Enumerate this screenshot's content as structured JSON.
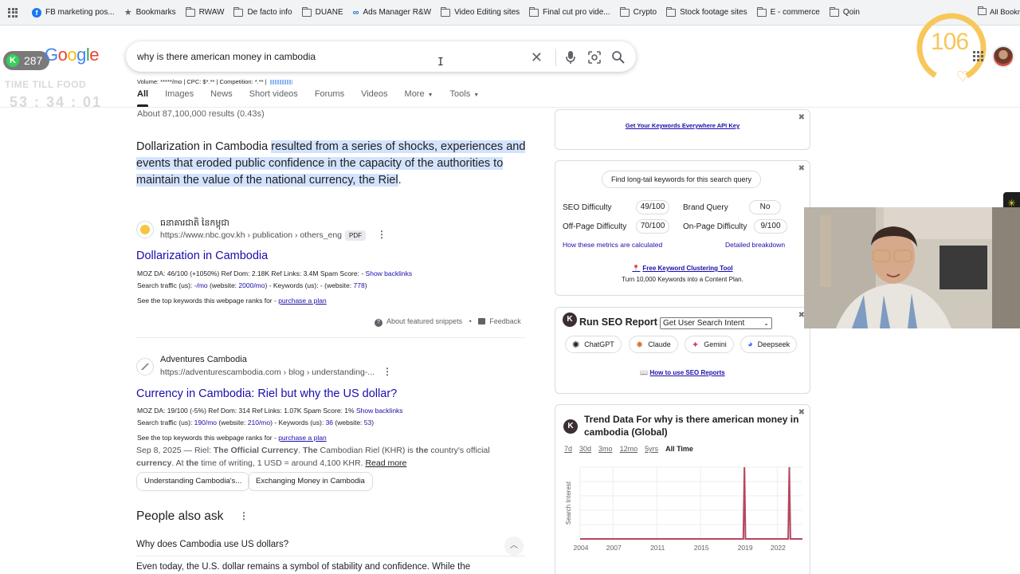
{
  "bookmarks": [
    {
      "label": "FB marketing pos...",
      "icon": "facebook-icon"
    },
    {
      "label": "Bookmarks",
      "icon": "star-icon"
    },
    {
      "label": "RWAW",
      "icon": "folder-icon"
    },
    {
      "label": "De facto info",
      "icon": "folder-icon"
    },
    {
      "label": "DUANE",
      "icon": "folder-icon"
    },
    {
      "label": "Ads Manager R&W",
      "icon": "meta-icon"
    },
    {
      "label": "Video Editing sites",
      "icon": "folder-icon"
    },
    {
      "label": "Final cut pro vide...",
      "icon": "folder-icon"
    },
    {
      "label": "Crypto",
      "icon": "folder-icon"
    },
    {
      "label": "Stock footage sites",
      "icon": "folder-icon"
    },
    {
      "label": "E - commerce",
      "icon": "folder-icon"
    },
    {
      "label": "Qoin",
      "icon": "folder-icon"
    }
  ],
  "all_bookmarks": "All Bookmarks",
  "overlay": {
    "k_count": "287",
    "timer_label": "TIME TILL FOOD",
    "timer": "53 : 34 : 01",
    "seo_score": "106"
  },
  "google_logo": [
    "G",
    "o",
    "o",
    "g",
    "l",
    "e"
  ],
  "search": {
    "query": "why is there american money in cambodia",
    "volume_line": "Volume: *****/mo | CPC: $*.** | Competition: *.** |"
  },
  "tabs": [
    "All",
    "Images",
    "News",
    "Short videos",
    "Forums",
    "Videos",
    "More",
    "Tools"
  ],
  "stats": "About 87,100,000 results (0.43s)",
  "featured": {
    "plain": "Dollarization in Cambodia ",
    "highlight": "resulted from a series of shocks, experiences and events that eroded public confidence in the capacity of the authorities to maintain the value of the national currency, the Riel",
    "end": ".",
    "site_name": "ធនាគារជាតិ នៃកម្ពុជា",
    "url": "https://www.nbc.gov.kh › publication › others_eng",
    "badge": "PDF",
    "title": "Dollarization in Cambodia",
    "moz": "MOZ DA: 46/100 (+1050%)     Ref Dom: 2.18K     Ref Links: 3.4M     Spam Score: -",
    "show_backlinks": "Show backlinks",
    "traffic_prefix": "Search traffic (us): ",
    "traffic_mo": "-/mo",
    "traffic_mid": " (website: ",
    "traffic_site": "2000/mo",
    "traffic_kw": ") - Keywords (us): - (website: ",
    "traffic_kw_site": "778",
    "traffic_end": ")",
    "top_kw": "See the top keywords this webpage ranks for - ",
    "purchase": "purchase a plan",
    "about": "About featured snippets",
    "feedback": "Feedback"
  },
  "result2": {
    "site_name": "Adventures Cambodia",
    "url": "https://adventurescambodia.com › blog › understanding-...",
    "title": "Currency in Cambodia: Riel but why the US dollar?",
    "moz": "MOZ DA: 19/100 (-5%)     Ref Dom: 314     Ref Links: 1.07K     Spam Score: 1%",
    "show_backlinks": "Show backlinks",
    "traffic_prefix": "Search traffic (us): ",
    "traffic_mo": "190/mo",
    "traffic_mid": " (website: ",
    "traffic_site": "210/mo",
    "traffic_kw": ") - Keywords (us): ",
    "traffic_kw_val": "36",
    "traffic_kw2": " (website: ",
    "traffic_kw_site": "53",
    "traffic_end": ")",
    "top_kw": "See the top keywords this webpage ranks for - ",
    "purchase": "purchase a plan",
    "date": "Sep 8, 2025 — Riel: ",
    "b1": "The Official Currency",
    "mid1": ". ",
    "b2": "The",
    "mid2": " Cambodian Riel (KHR) is ",
    "b3": "the",
    "mid3": " country's official ",
    "b4": "currency",
    "mid4": ". At ",
    "b5": "the",
    "mid5": " time of writing, 1 USD = around 4,100 KHR.  ",
    "read_more": "Read more",
    "chips": [
      "Understanding Cambodia's...",
      "Exchanging Money in Cambodia"
    ]
  },
  "paa": {
    "heading": "People also ask",
    "q1": "Why does Cambodia use US dollars?",
    "answer_start": "Even today, the U.S. dollar remains a symbol of stability and confidence. While the"
  },
  "panel1": {
    "link": "Get Your Keywords Everywhere API Key"
  },
  "panel2": {
    "button": "Find long-tail keywords for this search query",
    "seo_difficulty_label": "SEO Difficulty",
    "seo_difficulty": "49/100",
    "brand_query_label": "Brand Query",
    "brand_query": "No",
    "offpage_label": "Off-Page Difficulty",
    "offpage": "70/100",
    "onpage_label": "On-Page Difficulty",
    "onpage": "9/100",
    "how_link": "How these metrics are calculated",
    "detail_link": "Detailed breakdown",
    "cluster_link": "Free Keyword Clustering Tool",
    "cluster_sub": "Turn 10,000 Keywords into a Content Plan."
  },
  "panel3": {
    "title": "Run SEO Report",
    "select": "Get User Search Intent",
    "ai_buttons": [
      {
        "label": "ChatGPT",
        "icon": "chatgpt-icon"
      },
      {
        "label": "Claude",
        "icon": "claude-icon"
      },
      {
        "label": "Gemini",
        "icon": "gemini-icon"
      },
      {
        "label": "Deepseek",
        "icon": "deepseek-icon"
      }
    ],
    "howto": "How to use SEO Reports"
  },
  "panel4": {
    "title": "Trend Data For why is there american money in cambodia (Global)",
    "ranges": [
      "7d",
      "30d",
      "3mo",
      "12mo",
      "5yrs",
      "All Time"
    ],
    "active_range": "All Time"
  },
  "chart_data": {
    "type": "line",
    "title": "",
    "xlabel": "",
    "ylabel": "Search Interest",
    "x_ticks": [
      "2004",
      "2007",
      "2011",
      "2015",
      "2019",
      "2022"
    ],
    "x": [
      2004,
      2018.9,
      2019.0,
      2019.1,
      2023.0,
      2023.1,
      2023.2,
      2024.3
    ],
    "y": [
      0,
      0,
      100,
      0,
      0,
      100,
      0,
      0
    ],
    "color": "#b5475e",
    "grid": true
  }
}
